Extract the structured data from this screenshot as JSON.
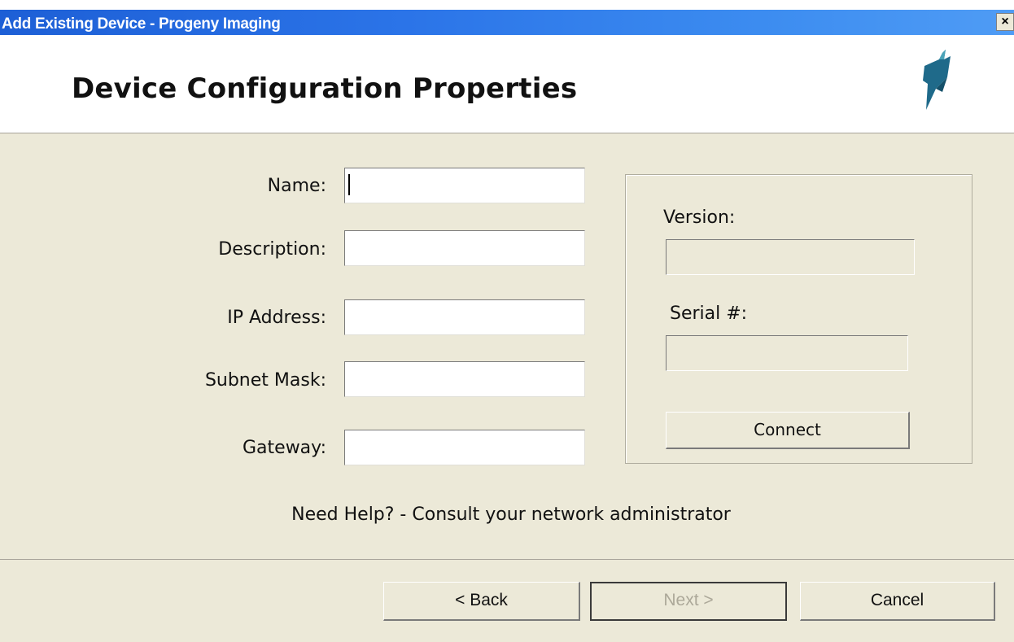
{
  "window": {
    "title": "Add Existing Device - Progeny Imaging",
    "close_glyph": "×",
    "close_icon": "close-icon"
  },
  "header": {
    "title": "Device Configuration Properties",
    "logo_icon": "progeny-logo-icon",
    "logo_color": "#1f6a8a"
  },
  "form": {
    "name": {
      "label": "Name:",
      "value": ""
    },
    "description": {
      "label": "Description:",
      "value": ""
    },
    "ip_address": {
      "label": "IP Address:",
      "value": ""
    },
    "subnet_mask": {
      "label": "Subnet Mask:",
      "value": ""
    },
    "gateway": {
      "label": "Gateway:",
      "value": ""
    }
  },
  "device_info": {
    "version_label": "Version:",
    "version_value": "",
    "serial_label": "Serial #:",
    "serial_value": "",
    "connect_label": "Connect"
  },
  "help_text": "Need Help? - Consult your network administrator",
  "buttons": {
    "back": "< Back",
    "next": "Next >",
    "next_enabled": false,
    "cancel": "Cancel"
  },
  "colors": {
    "titlebar": "#2b74e8",
    "dialog_background": "#ece9d8"
  }
}
